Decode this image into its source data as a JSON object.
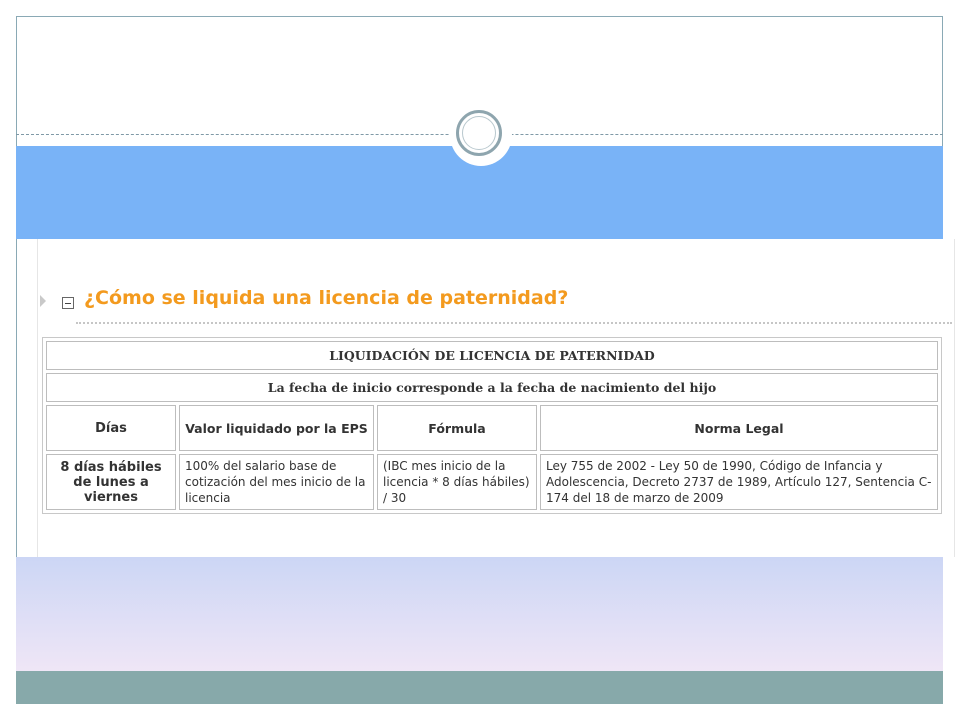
{
  "heading": "¿Cómo se liquida una licencia de paternidad?",
  "table": {
    "title": "LIQUIDACIÓN DE LICENCIA DE PATERNIDAD",
    "subtitle": "La fecha de inicio corresponde a la fecha de nacimiento del hijo",
    "headers": [
      "Días",
      "Valor liquidado por la EPS",
      "Fórmula",
      "Norma Legal"
    ],
    "row": [
      "8 días hábiles de lunes a viernes",
      "100% del salario base de cotización del mes inicio de la licencia",
      "(IBC mes inicio de la licencia * 8 días hábiles) / 30",
      "Ley 755 de 2002 - Ley 50 de 1990, Código de Infancia y Adolescencia, Decreto 2737 de 1989, Artículo 127, Sentencia C-174 del 18 de marzo de 2009"
    ]
  },
  "icons": {
    "expand_arrow": "triangle-right-icon",
    "collapse": "minus-box-icon"
  },
  "colors": {
    "heading": "#f39a1e",
    "top_band": "#79b3f7",
    "footer_band": "#87a9aa"
  }
}
